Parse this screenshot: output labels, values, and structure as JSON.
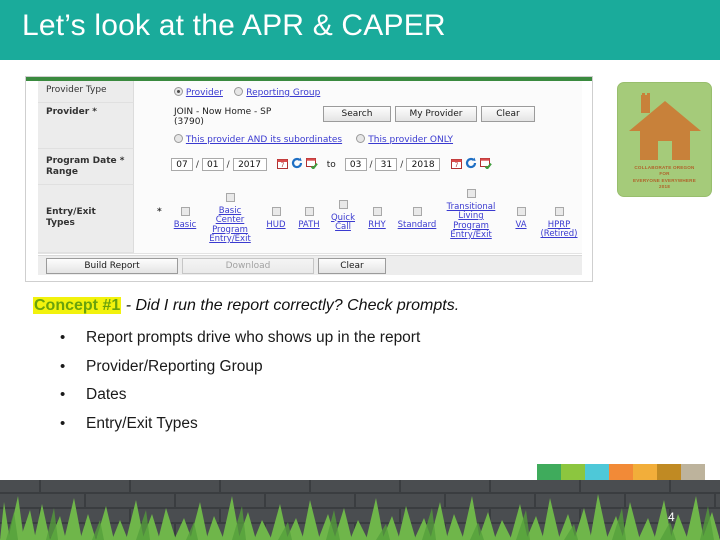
{
  "slide": {
    "title": "Let’s look at the APR & CAPER",
    "page_number": "4",
    "title_bar_color": "#1aab9b"
  },
  "logo": {
    "line1": "COLLABORATE OREGON",
    "line2": "FOR",
    "line3": "EVERYONE EVERYWHERE",
    "line4": "2018",
    "bg_color": "#a5cb7a",
    "house_color": "#c8813a"
  },
  "form": {
    "provider_type": {
      "label": "Provider Type",
      "options": [
        {
          "label": "Provider",
          "selected": true
        },
        {
          "label": "Reporting Group",
          "selected": false
        }
      ]
    },
    "provider": {
      "label": "Provider",
      "required_marker": "*",
      "value_line1": "JOIN - Now Home - SP",
      "value_line2": "(3790)",
      "buttons": [
        "Search",
        "My Provider",
        "Clear"
      ],
      "scope_options": [
        {
          "label": "This provider AND its subordinates",
          "selected": false
        },
        {
          "label": "This provider ONLY",
          "selected": false
        }
      ]
    },
    "date_range": {
      "label_line1": "Program Date",
      "label_line2": "Range",
      "required_marker": "*",
      "start": {
        "month": "07",
        "day": "01",
        "year": "2017"
      },
      "separator": "to",
      "end": {
        "month": "03",
        "day": "31",
        "year": "2018"
      },
      "icons": [
        "calendar-icon",
        "refresh-icon",
        "calendar-check-icon"
      ]
    },
    "entry_exit": {
      "label_line1": "Entry/Exit",
      "label_line2": "Types",
      "required_marker": "*",
      "types": [
        {
          "label": "Basic",
          "checked": false
        },
        {
          "label": "Basic Center Program Entry/Exit",
          "checked": false
        },
        {
          "label": "HUD",
          "checked": false
        },
        {
          "label": "PATH",
          "checked": false
        },
        {
          "label": "Quick Call",
          "checked": false
        },
        {
          "label": "RHY",
          "checked": false
        },
        {
          "label": "Standard",
          "checked": false
        },
        {
          "label": "Transitional Living Program Entry/Exit",
          "checked": false
        },
        {
          "label": "VA",
          "checked": false
        },
        {
          "label": "HPRP (Retired)",
          "checked": false
        }
      ]
    },
    "actions": [
      {
        "label": "Build Report",
        "disabled": false
      },
      {
        "label": "Download",
        "disabled": true
      },
      {
        "label": "Clear",
        "disabled": false
      }
    ]
  },
  "concept": {
    "tag": "Concept #1",
    "rest": " - Did I run the report correctly? Check prompts.",
    "tag_text_color": "#6aa20c",
    "tag_highlight_color": "#f2f20d"
  },
  "bullets": [
    "Report prompts drive who shows up in the report",
    "Provider/Reporting Group",
    "Dates",
    "Entry/Exit Types"
  ],
  "footer": {
    "swatch_colors": [
      "#3fab5c",
      "#8cc63f",
      "#4ec8d8",
      "#f28a37",
      "#f2ae3a",
      "#c08a23",
      "#bdb39c"
    ],
    "wall_color": "#4a4d50",
    "grass_color": "#6fb64a"
  }
}
